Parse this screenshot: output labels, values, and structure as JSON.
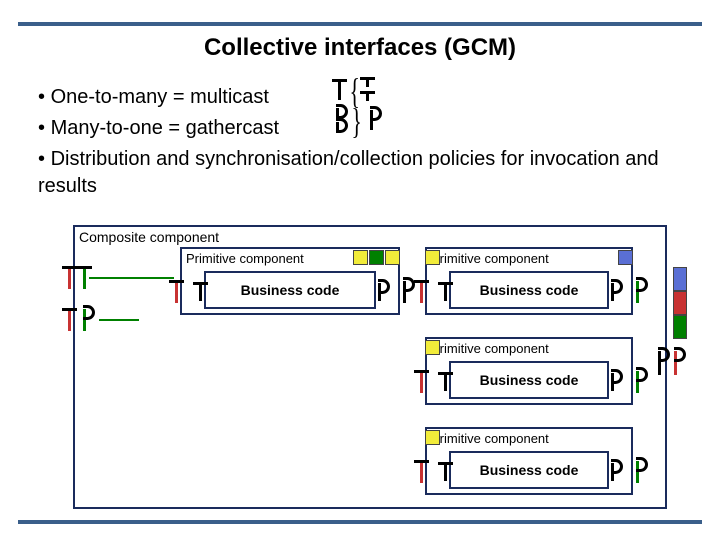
{
  "title": "Collective interfaces (GCM)",
  "bullets": [
    "One-to-many = multicast",
    "Many-to-one = gathercast",
    "Distribution and synchronisation/collection policies for invocation and results"
  ],
  "composite_label": "Composite component",
  "primitive_label": "Primitive component",
  "business_label": "Business code",
  "colors": {
    "yellow": "#f2ec3a",
    "green": "#008000",
    "blue": "#5a6fd4",
    "red": "#c83232",
    "orange": "#e88a2a"
  }
}
